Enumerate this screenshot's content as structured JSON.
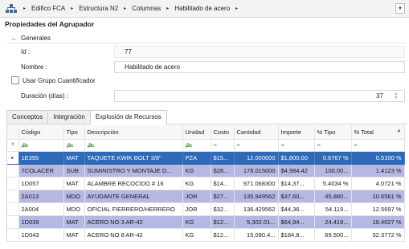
{
  "breadcrumb": {
    "items": [
      "Edifico FCA",
      "Estructura N2",
      "Columnas",
      "Habilitado de acero"
    ],
    "separator": "▸",
    "dropdown": "▼"
  },
  "panel": {
    "title": "Propiedades del Agrupador"
  },
  "group": {
    "chevron": "︿",
    "label": "Generales",
    "id_label": "Id :",
    "id_value": "77",
    "nombre_label": "Nombre :",
    "nombre_value": "Habilitado de acero",
    "checkbox_label": "Usar Grupo Cuantificador",
    "duracion_label": "Duración (días) :",
    "duracion_value": "37",
    "spin_up": "▲",
    "spin_down": "▼"
  },
  "tabs": [
    "Conceptos",
    "Integración",
    "Explosión de Recursos"
  ],
  "grid": {
    "columns": [
      "Código",
      "Tipo",
      "Descripción",
      "Unidad",
      "Costo",
      "Cantidad",
      "Importe",
      "% Tipo",
      "% Total"
    ],
    "sort_arrow": "▲",
    "filter_icon": "ₐBc",
    "filter_eq": "=",
    "row_marker": "▸",
    "filter_row_icon": "₹",
    "rows": [
      {
        "codigo": "1E395",
        "tipo": "MAT",
        "descripcion": "TAQUETE KWIK BOLT 3/8\"",
        "unidad": "PZA",
        "costo": "$15...",
        "cantidad": "12.000000",
        "importe": "$1,800.00",
        "pct_tipo": "0.6767 %",
        "pct_total": "0.5100 %"
      },
      {
        "codigo": "7COLACER",
        "tipo": "SUB",
        "descripcion": "SUMINISTRO Y MONTAJE D...",
        "unidad": "KG",
        "costo": "$28...",
        "cantidad": "178.015000",
        "importe": "$4,984.42",
        "pct_tipo": "100.00...",
        "pct_total": "1.4123 %"
      },
      {
        "codigo": "1D057",
        "tipo": "MAT",
        "descripcion": "ALAMBRE RECOCIDO # 16",
        "unidad": "KG",
        "costo": "$14...",
        "cantidad": "971.068300",
        "importe": "$14,37...",
        "pct_tipo": "5.4034 %",
        "pct_total": "4.0721 %"
      },
      {
        "codigo": "2A013",
        "tipo": "MDO",
        "descripcion": "AYUDANTE GENERAL",
        "unidad": "JOR",
        "costo": "$27...",
        "cantidad": "135.949562",
        "importe": "$37,60...",
        "pct_tipo": "45.880...",
        "pct_total": "10.6561 %"
      },
      {
        "codigo": "2A004",
        "tipo": "MDO",
        "descripcion": "OFICIAL FIERRERO/HERRERO",
        "unidad": "JOR",
        "costo": "$32...",
        "cantidad": "136.429562",
        "importe": "$44,36...",
        "pct_tipo": "54.119...",
        "pct_total": "12.5697 %"
      },
      {
        "codigo": "1D039",
        "tipo": "MAT",
        "descripcion": "ACERO NO 3 AR-42",
        "unidad": "KG",
        "costo": "$12...",
        "cantidad": "5,302.01...",
        "importe": "$64,94...",
        "pct_tipo": "24.419...",
        "pct_total": "18.4027 %"
      },
      {
        "codigo": "1D043",
        "tipo": "MAT",
        "descripcion": "ACERO NO 8 AR-42",
        "unidad": "KG",
        "costo": "$12...",
        "cantidad": "15,090.4...",
        "importe": "$184,8...",
        "pct_tipo": "69.500...",
        "pct_total": "52.3772 %"
      }
    ]
  },
  "colors": {
    "selected_row": "#2e6ab8",
    "alt_row": "#b4b8e2",
    "filter_icon": "#3b8c3b"
  }
}
